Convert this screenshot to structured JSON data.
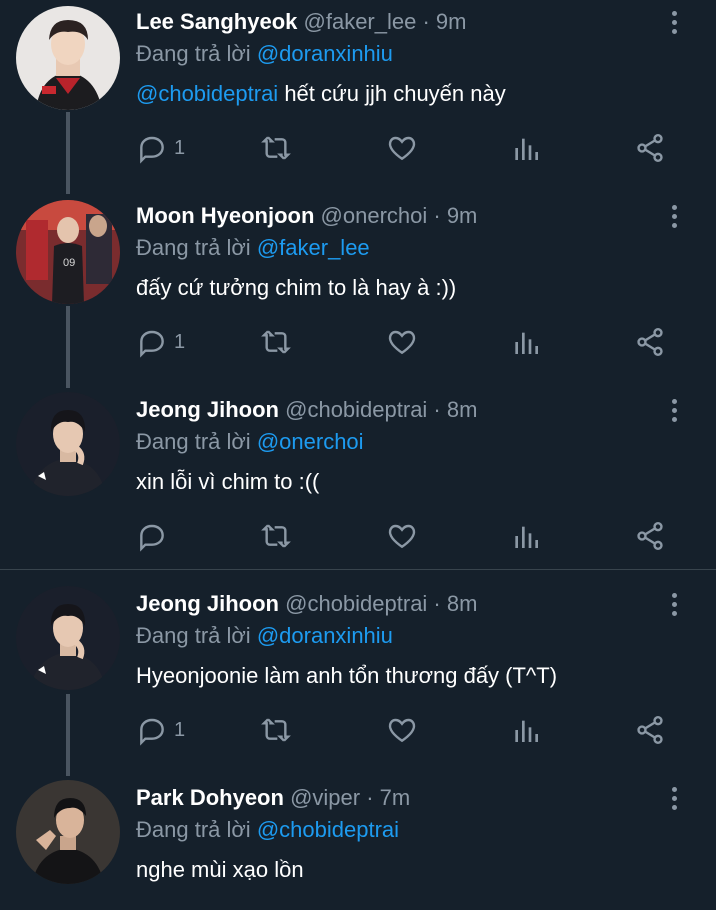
{
  "reply_prefix": "Đang trả lời",
  "tweets": [
    {
      "name": "Lee Sanghyeok",
      "handle": "@faker_lee",
      "time": "9m",
      "meta": "@faker_lee · 9m",
      "replying_to": "@doranxinhiu",
      "mention": "@chobideptrai",
      "text": " hết cứu jjh chuyến này",
      "reply_count": "1"
    },
    {
      "name": "Moon Hyeonjoon",
      "handle": "@onerchoi",
      "time": "9m",
      "meta": "@onerchoi · 9m",
      "replying_to": "@faker_lee",
      "mention": "",
      "text": "đấy cứ tưởng chim to là hay à :))",
      "reply_count": "1"
    },
    {
      "name": "Jeong Jihoon",
      "handle": "@chobideptrai",
      "time": "8m",
      "meta": "@chobideptrai · 8m",
      "replying_to": "@onerchoi",
      "mention": "",
      "text": "xin lỗi vì chim to :((",
      "reply_count": ""
    },
    {
      "name": "Jeong Jihoon",
      "handle": "@chobideptrai",
      "time": "8m",
      "meta": "@chobideptrai · 8m",
      "replying_to": "@doranxinhiu",
      "mention": "",
      "text": "Hyeonjoonie làm anh tổn thương đấy (T^T)",
      "reply_count": "1"
    },
    {
      "name": "Park Dohyeon",
      "handle": "@viper",
      "time": "7m",
      "meta": "@viper · 7m",
      "replying_to": "@chobideptrai",
      "mention": "",
      "text": "nghe mùi xạo lồn",
      "reply_count": ""
    }
  ],
  "icons": {
    "reply": "reply-icon",
    "retweet": "retweet-icon",
    "like": "heart-icon",
    "views": "analytics-icon",
    "share": "share-icon",
    "more": "more-vertical-icon"
  },
  "colors": {
    "background": "#15202b",
    "accent": "#1d9bf0",
    "secondary_text": "#8b98a5",
    "primary_text": "#ffffff"
  }
}
